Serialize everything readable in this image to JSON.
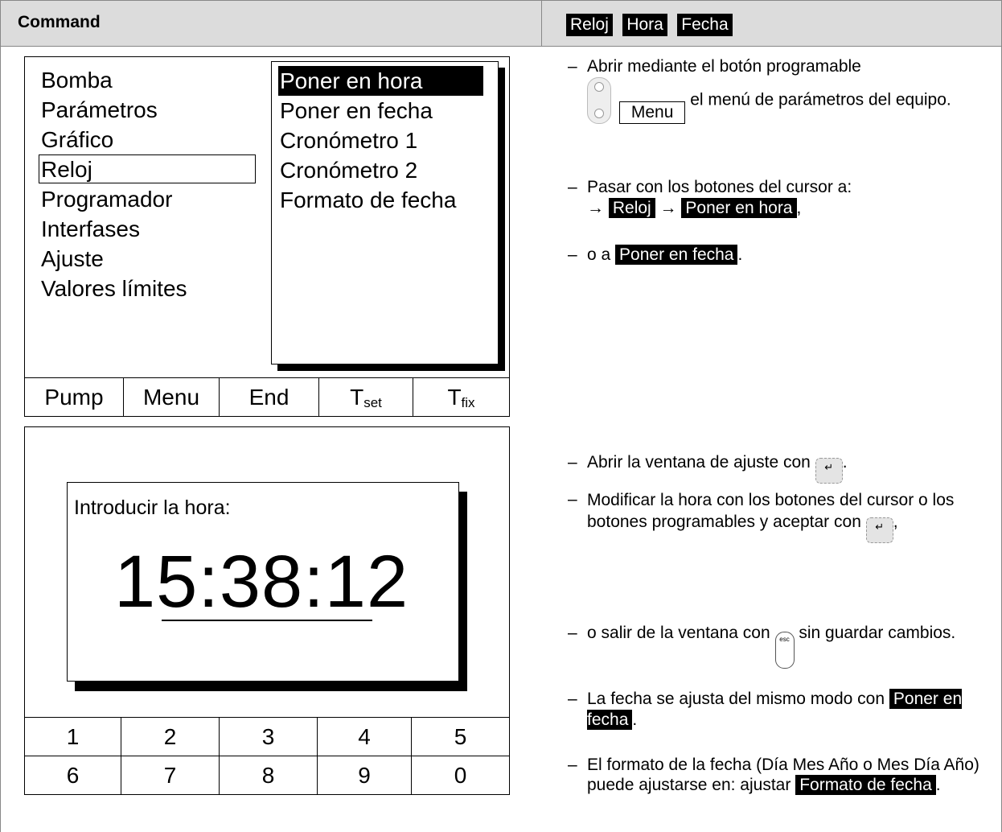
{
  "header": {
    "title": "Command",
    "tags": [
      "Reloj",
      "Hora",
      "Fecha"
    ]
  },
  "screen1": {
    "menu_items": [
      "Bomba",
      "Parámetros",
      "Gráfico",
      "Reloj",
      "Programador",
      "Interfases",
      "Ajuste",
      "Valores límites"
    ],
    "selected_menu_item": "Reloj",
    "submenu_items": [
      "Poner en hora",
      "Poner en fecha",
      "Cronómetro 1",
      "Cronómetro 2",
      "Formato de fecha"
    ],
    "selected_submenu_item": "Poner en hora",
    "softkeys": [
      {
        "main": "Pump",
        "sub": ""
      },
      {
        "main": "Menu",
        "sub": ""
      },
      {
        "main": "End",
        "sub": ""
      },
      {
        "main": "T",
        "sub": "set"
      },
      {
        "main": "T",
        "sub": "fix"
      }
    ]
  },
  "screen2": {
    "dialog_label": "Introducir la hora:",
    "time_value": "15:38:12",
    "number_keys_row1": [
      "1",
      "2",
      "3",
      "4",
      "5"
    ],
    "number_keys_row2": [
      "6",
      "7",
      "8",
      "9",
      "0"
    ]
  },
  "instructions": {
    "p1_text_a": "Abrir mediante el botón programable",
    "p1_key": "Menu",
    "p1_text_b": "el menú de parámetros del equipo.",
    "p2_text": "Pasar con los botones del cursor a:",
    "p2_arrow": "→",
    "p2_tag1": "Reloj",
    "p2_tag2": "Poner en hora",
    "p3_text": "o a",
    "p3_tag": "Poner en fecha",
    "p4_text": "Abrir la ventana de ajuste con",
    "p5_text_a": "Modificar la hora con los botones del cursor o los botones programables y aceptar con",
    "p6_text_a": "o salir de la ventana con",
    "p6_text_b": "sin guardar cambios.",
    "p7_text": "La fecha se ajusta del mismo modo con",
    "p7_tag": "Poner en fecha",
    "p8_text": "El formato de la fecha (Día Mes Año o Mes Día Año) puede ajustarse en: ajustar",
    "p8_tag": "Formato de fecha",
    "dash": "–",
    "esc_label": "esc"
  }
}
